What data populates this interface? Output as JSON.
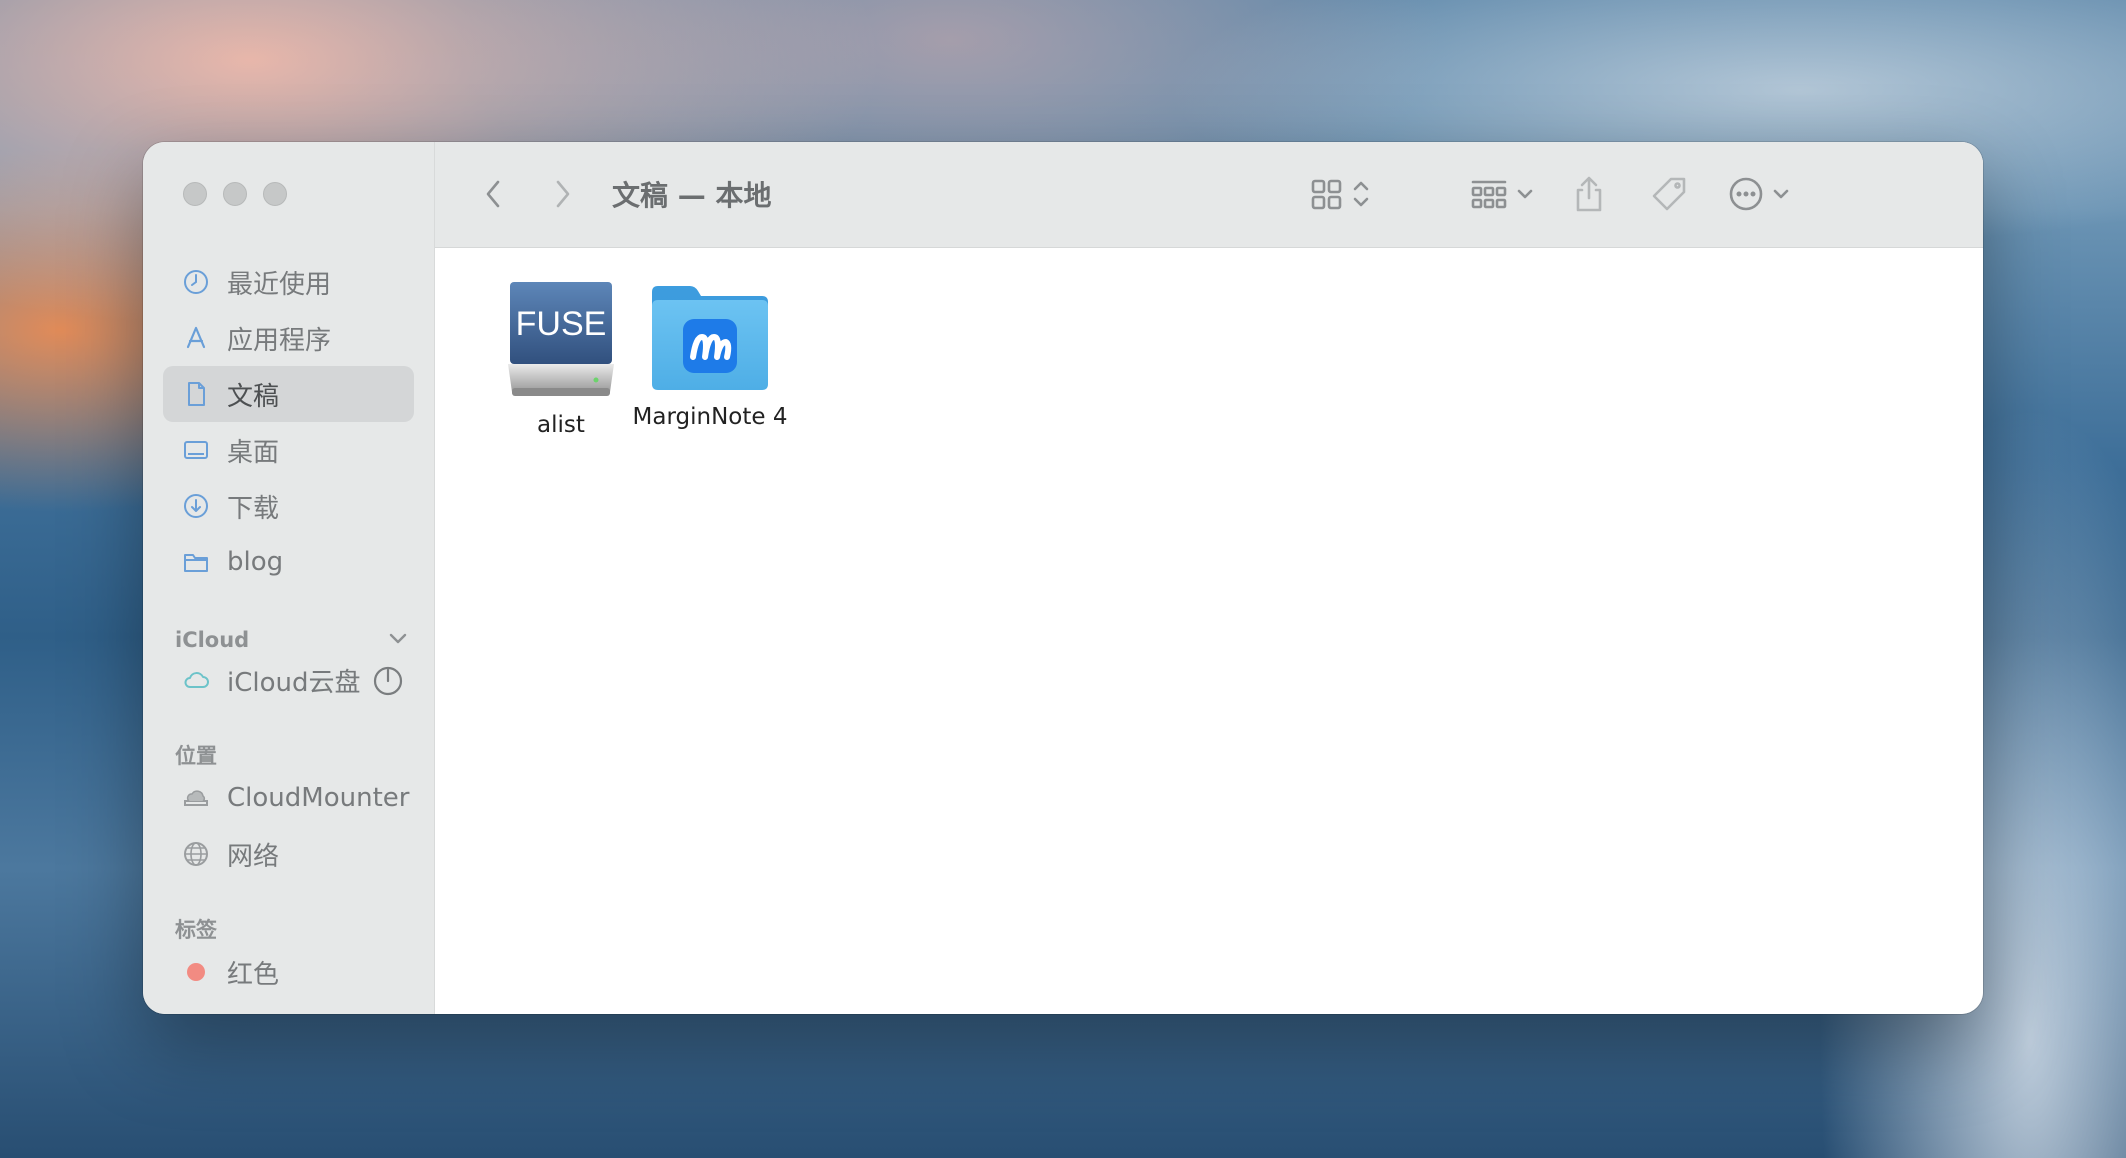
{
  "window": {
    "title": "文稿 — 本地"
  },
  "sidebar": {
    "favorites": [
      {
        "label": "最近使用",
        "icon": "clock-icon"
      },
      {
        "label": "应用程序",
        "icon": "app-store-icon"
      },
      {
        "label": "文稿",
        "icon": "document-icon",
        "selected": true
      },
      {
        "label": "桌面",
        "icon": "desktop-icon"
      },
      {
        "label": "下载",
        "icon": "download-icon"
      },
      {
        "label": "blog",
        "icon": "folder-icon"
      }
    ],
    "icloud_section": "iCloud",
    "icloud_items": [
      {
        "label": "iCloud云盘",
        "icon": "cloud-icon"
      }
    ],
    "locations_section": "位置",
    "locations": [
      {
        "label": "CloudMounter",
        "icon": "cloud-drive-icon"
      },
      {
        "label": "网络",
        "icon": "globe-icon"
      }
    ],
    "tags_section": "标签",
    "tags": [
      {
        "label": "红色",
        "color": "#f28b82"
      }
    ]
  },
  "files": [
    {
      "name": "alist",
      "icon": "fuse-drive-icon",
      "badge": "FUSE"
    },
    {
      "name": "MarginNote 4",
      "icon": "marginnote-folder-icon"
    }
  ],
  "colors": {
    "folder_blue": "#5fb8ee",
    "accent": "#1e7be8"
  }
}
